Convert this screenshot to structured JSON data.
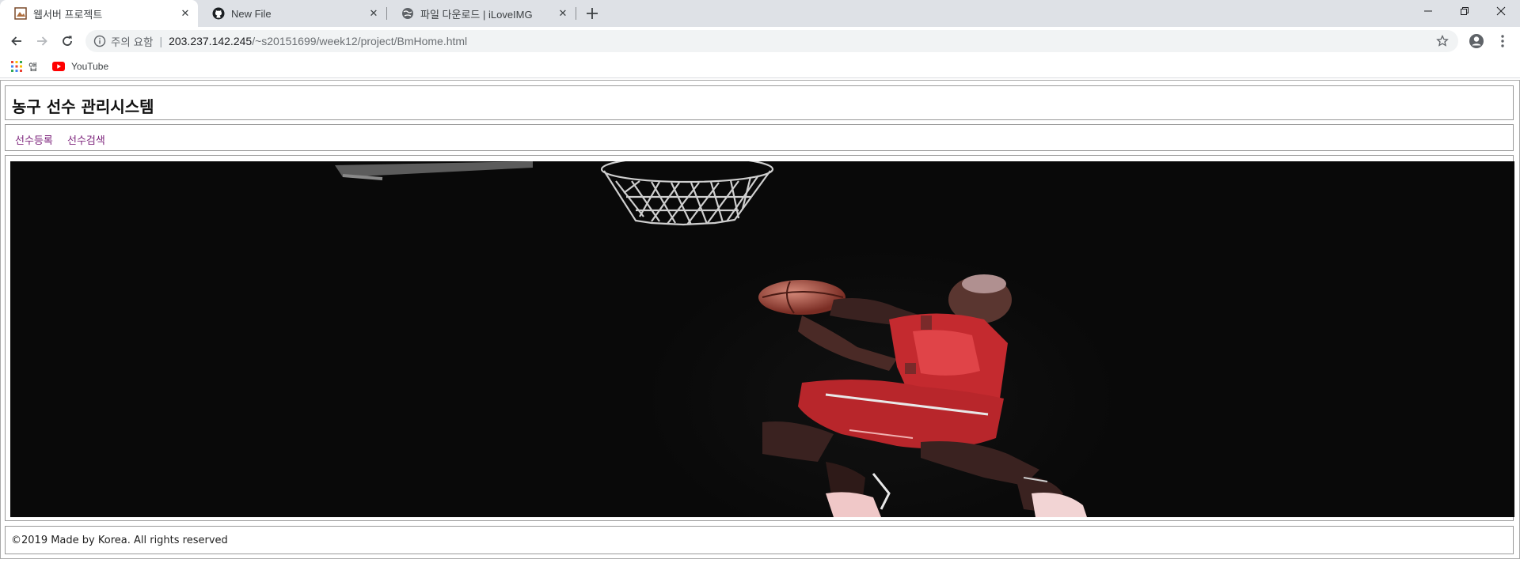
{
  "browser": {
    "tabs": [
      {
        "title": "웹서버 프로젝트",
        "active": true
      },
      {
        "title": "New File",
        "active": false
      },
      {
        "title": "파일 다운로드 | iLoveIMG",
        "active": false
      }
    ],
    "address": {
      "warning": "주의 요함",
      "host": "203.237.142.245",
      "path": "/~s20151699/week12/project/BmHome.html"
    },
    "bookmarks": [
      {
        "label": "앱",
        "icon": "apps-grid-icon"
      },
      {
        "label": "YouTube",
        "icon": "youtube-icon"
      }
    ]
  },
  "page": {
    "title": "농구 선수 관리시스템",
    "nav": [
      {
        "label": "선수등록"
      },
      {
        "label": "선수검색"
      }
    ],
    "hero_image": "basketball-player-dunk-image",
    "footer": "©2019 Made by Korea. All rights reserved"
  },
  "colors": {
    "nav_link": "#7a1f79",
    "tabstrip_bg": "#dee1e6",
    "hero_bg": "#090909",
    "jersey_red": "#c42a2f"
  }
}
